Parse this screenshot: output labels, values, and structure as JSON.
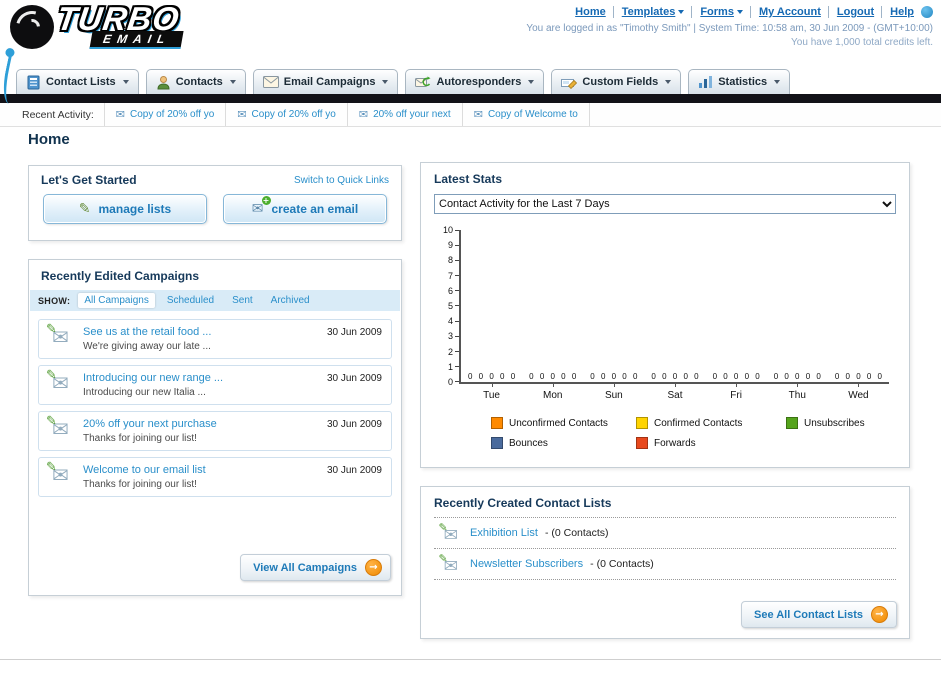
{
  "header": {
    "logo": {
      "primary": "TURBO",
      "secondary": "EMAIL"
    },
    "top_links": [
      {
        "label": "Home",
        "dropdown": false
      },
      {
        "label": "Templates",
        "dropdown": true
      },
      {
        "label": "Forms",
        "dropdown": true
      },
      {
        "label": "My Account",
        "dropdown": false
      },
      {
        "label": "Logout",
        "dropdown": false
      },
      {
        "label": "Help",
        "dropdown": false
      }
    ],
    "login_info": "You are logged in as \"Timothy Smith\" | System Time: 10:58 am, 30 Jun 2009 - (GMT+10:00)",
    "credits_info": "You have 1,000 total credits left."
  },
  "main_nav": {
    "items": [
      {
        "label": "Contact Lists"
      },
      {
        "label": "Contacts"
      },
      {
        "label": "Email Campaigns"
      },
      {
        "label": "Autoresponders"
      },
      {
        "label": "Custom Fields"
      },
      {
        "label": "Statistics"
      }
    ]
  },
  "recent_activity": {
    "label": "Recent Activity:",
    "items": [
      {
        "label": "Copy of 20% off yo"
      },
      {
        "label": "Copy of 20% off yo"
      },
      {
        "label": "20% off your next"
      },
      {
        "label": "Copy of Welcome to"
      }
    ]
  },
  "page": {
    "title": "Home"
  },
  "get_started": {
    "title": "Let's Get Started",
    "switch_link": "Switch to Quick Links",
    "manage_lists_label": "manage lists",
    "create_email_label": "create an email"
  },
  "campaigns": {
    "title": "Recently Edited Campaigns",
    "show_label": "SHOW:",
    "tabs": [
      {
        "label": "All Campaigns",
        "active": true
      },
      {
        "label": "Scheduled",
        "active": false
      },
      {
        "label": "Sent",
        "active": false
      },
      {
        "label": "Archived",
        "active": false
      }
    ],
    "items": [
      {
        "title": "See us at the retail food ...",
        "subtitle": "We're giving away our late ...",
        "date": "30 Jun 2009"
      },
      {
        "title": "Introducing our new range ...",
        "subtitle": "Introducing our new Italia ...",
        "date": "30 Jun 2009"
      },
      {
        "title": "20% off your next purchase",
        "subtitle": "Thanks for joining our list!",
        "date": "30 Jun 2009"
      },
      {
        "title": "Welcome to our email list",
        "subtitle": "Thanks for joining our list!",
        "date": "30 Jun 2009"
      }
    ],
    "view_all_label": "View All Campaigns"
  },
  "stats": {
    "title": "Latest Stats",
    "dropdown_value": "Contact Activity for the Last 7 Days",
    "chart_data": {
      "type": "bar",
      "title": "Contact Activity for the Last 7 Days",
      "categories": [
        "Tue",
        "Mon",
        "Sun",
        "Sat",
        "Fri",
        "Thu",
        "Wed"
      ],
      "series": [
        {
          "name": "Unconfirmed Contacts",
          "color": "#FF8A00",
          "values": [
            0,
            0,
            0,
            0,
            0,
            0,
            0
          ]
        },
        {
          "name": "Confirmed Contacts",
          "color": "#FFD400",
          "values": [
            0,
            0,
            0,
            0,
            0,
            0,
            0
          ]
        },
        {
          "name": "Unsubscribes",
          "color": "#55A41C",
          "values": [
            0,
            0,
            0,
            0,
            0,
            0,
            0
          ]
        },
        {
          "name": "Bounces",
          "color": "#4A6B9D",
          "values": [
            0,
            0,
            0,
            0,
            0,
            0,
            0
          ]
        },
        {
          "name": "Forwards",
          "color": "#E8491D",
          "values": [
            0,
            0,
            0,
            0,
            0,
            0,
            0
          ]
        }
      ],
      "ylim": [
        0,
        10
      ],
      "yticks": [
        0,
        1,
        2,
        3,
        4,
        5,
        6,
        7,
        8,
        9,
        10
      ],
      "legend_position": "bottom",
      "grid": false
    }
  },
  "contact_lists": {
    "title": "Recently Created Contact Lists",
    "items": [
      {
        "name": "Exhibition List",
        "detail": "- (0 Contacts)"
      },
      {
        "name": "Newsletter Subscribers",
        "detail": "- (0 Contacts)"
      }
    ],
    "see_all_label": "See All Contact Lists"
  }
}
